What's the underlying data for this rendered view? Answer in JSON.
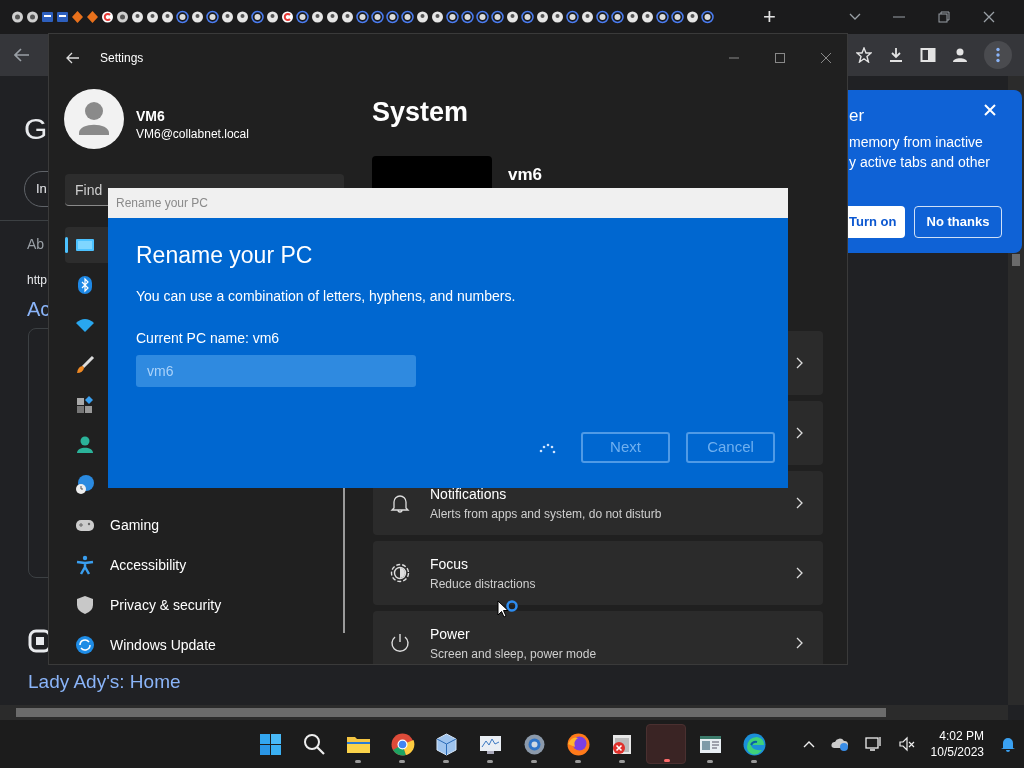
{
  "browser": {
    "new_tab": "+",
    "page_texts": [
      "G",
      "In",
      "Ab",
      "http",
      "Ac"
    ],
    "page_link": "Lady Ady's: Home"
  },
  "popup": {
    "title": "er",
    "lines": [
      "memory from inactive",
      "y active tabs and other"
    ],
    "buttons": [
      {
        "label": "Turn on",
        "kind": "primary"
      },
      {
        "label": "No thanks",
        "kind": "secondary"
      }
    ]
  },
  "settings": {
    "title": "Settings",
    "user": {
      "name": "VM6",
      "email": "VM6@collabnet.local"
    },
    "search": {
      "placeholder": "Find"
    },
    "nav": [
      {
        "kind": "display",
        "selected": true
      },
      {
        "kind": "bluetooth",
        "selected": false
      },
      {
        "kind": "wifi",
        "selected": false
      },
      {
        "kind": "brush",
        "selected": false
      },
      {
        "kind": "apps",
        "selected": false
      },
      {
        "kind": "person",
        "selected": false
      },
      {
        "kind": "globe",
        "selected": false
      },
      {
        "kind": "gamepad",
        "label": "Gaming",
        "selected": false
      },
      {
        "kind": "access",
        "label": "Accessibility",
        "selected": false
      },
      {
        "kind": "shield",
        "label": "Privacy & security",
        "selected": false
      },
      {
        "kind": "update",
        "label": "Windows Update",
        "selected": false
      }
    ],
    "heading": "System",
    "device_name": "vm6",
    "cards": [
      {
        "kind": "bell",
        "title": "Notifications",
        "subtitle": "Alerts from apps and system, do not disturb"
      },
      {
        "kind": "focus",
        "title": "Focus",
        "subtitle": "Reduce distractions"
      },
      {
        "kind": "power",
        "title": "Power",
        "subtitle": "Screen and sleep, power mode"
      }
    ]
  },
  "dialog": {
    "window_title": "Rename your PC",
    "title": "Rename your PC",
    "description": "You can use a combination of letters, hyphens, and numbers.",
    "label": "Current PC name: vm6",
    "input": {
      "placeholder": "vm6"
    },
    "busy": true,
    "buttons": [
      {
        "label": "Next",
        "disabled": true
      },
      {
        "label": "Cancel",
        "disabled": true
      }
    ]
  },
  "taskbar": {
    "apps": [
      {
        "kind": "start",
        "running": false,
        "selected": false
      },
      {
        "kind": "search",
        "running": false,
        "selected": false
      },
      {
        "kind": "folder",
        "running": true,
        "selected": false
      },
      {
        "kind": "chrome",
        "running": true,
        "selected": false
      },
      {
        "kind": "cube",
        "running": true,
        "selected": false
      },
      {
        "kind": "monitor",
        "running": true,
        "selected": false
      },
      {
        "kind": "gear",
        "running": true,
        "selected": false
      },
      {
        "kind": "firefox",
        "running": true,
        "selected": false
      },
      {
        "kind": "error",
        "running": true,
        "selected": false
      },
      {
        "kind": "blank",
        "running": true,
        "selected": true
      },
      {
        "kind": "window",
        "running": true,
        "selected": false
      },
      {
        "kind": "edge",
        "running": true,
        "selected": false
      }
    ],
    "time": "4:02 PM",
    "date": "10/5/2023"
  }
}
